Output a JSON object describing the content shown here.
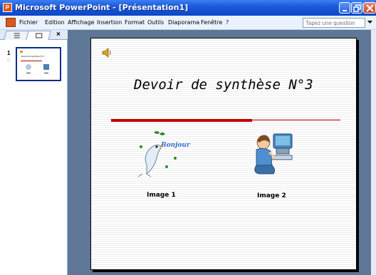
{
  "window": {
    "title": "Microsoft PowerPoint - [Présentation1]"
  },
  "menu": {
    "items": [
      "Fichier",
      "Edition",
      "Affichage",
      "Insertion",
      "Format",
      "Outils",
      "Diaporama",
      "Fenêtre",
      "?"
    ],
    "help_placeholder": "Tapez une question"
  },
  "left_panel": {
    "slide_number": "1",
    "close_glyph": "×",
    "thumbnail_title": "Devoir de synthèse N°3"
  },
  "slide": {
    "title": "Devoir de synthèse N°3",
    "bird_text": "Bonjour",
    "caption_1": "Image 1",
    "caption_2": "Image 2"
  },
  "icons": [
    "powerpoint-app-icon",
    "minimize-icon",
    "maximize-icon",
    "close-icon",
    "document-icon",
    "outline-tab-icon",
    "slides-tab-icon",
    "speaker-icon",
    "dropdown-arrow-icon"
  ],
  "colors": {
    "titlebar": "#0a46c8",
    "menubar": "#eaf2fd",
    "workspace": "#5e7796",
    "accent_red": "#c00000"
  }
}
